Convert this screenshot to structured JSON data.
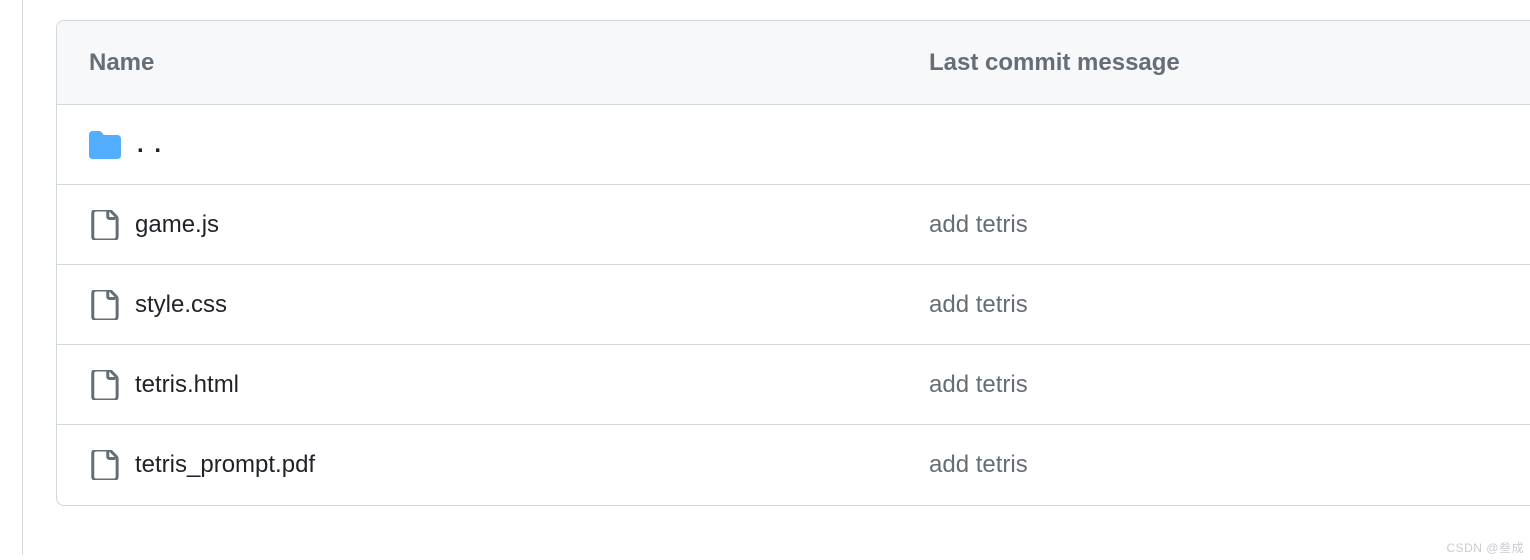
{
  "header": {
    "name_label": "Name",
    "commit_label": "Last commit message"
  },
  "parent_row": {
    "label": ". ."
  },
  "files": [
    {
      "name": "game.js",
      "commit": "add tetris"
    },
    {
      "name": "style.css",
      "commit": "add tetris"
    },
    {
      "name": "tetris.html",
      "commit": "add tetris"
    },
    {
      "name": "tetris_prompt.pdf",
      "commit": "add tetris"
    }
  ],
  "watermark": "CSDN @叁成"
}
